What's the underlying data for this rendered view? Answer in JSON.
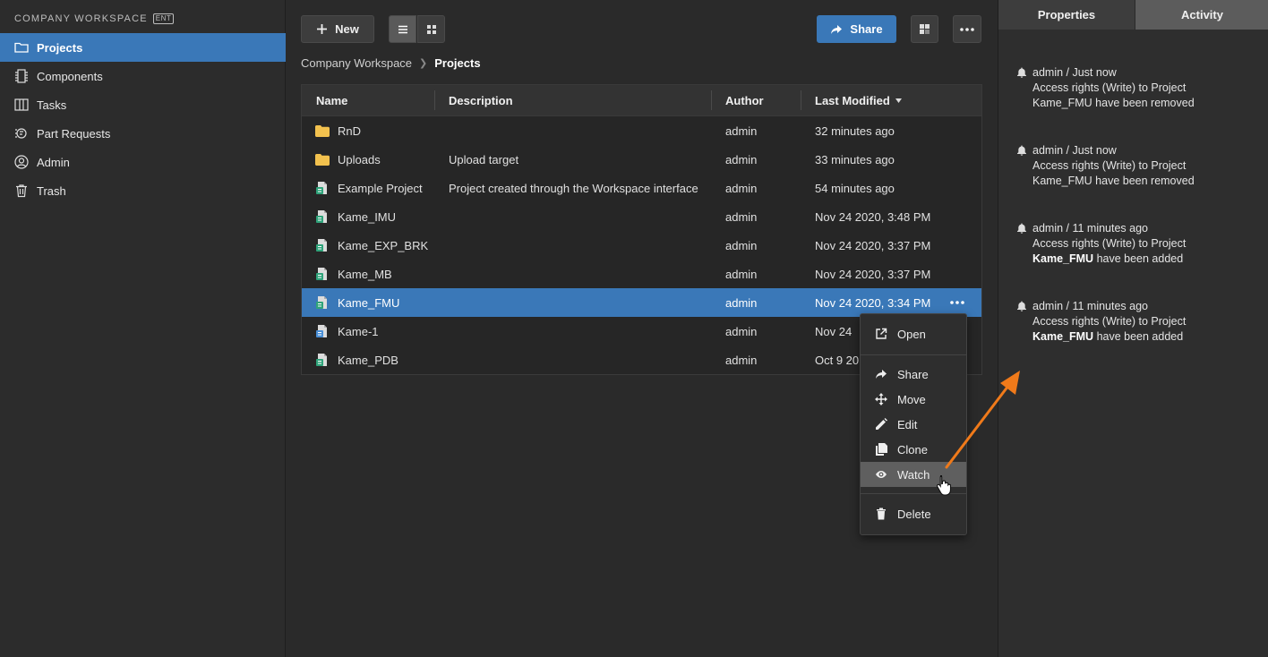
{
  "workspace": {
    "title": "COMPANY WORKSPACE",
    "badge": "ENT"
  },
  "sidebar": {
    "items": [
      {
        "label": "Projects",
        "icon": "folder-icon",
        "active": true
      },
      {
        "label": "Components",
        "icon": "chip-icon",
        "active": false
      },
      {
        "label": "Tasks",
        "icon": "kanban-icon",
        "active": false
      },
      {
        "label": "Part Requests",
        "icon": "part-request-icon",
        "active": false
      },
      {
        "label": "Admin",
        "icon": "user-circle-icon",
        "active": false
      },
      {
        "label": "Trash",
        "icon": "trash-icon",
        "active": false
      }
    ]
  },
  "toolbar": {
    "new_label": "New",
    "share_label": "Share"
  },
  "breadcrumb": {
    "root": "Company Workspace",
    "current": "Projects"
  },
  "table": {
    "columns": [
      "Name",
      "Description",
      "Author",
      "Last Modified"
    ],
    "sort_column": "Last Modified",
    "rows": [
      {
        "type": "folder",
        "name": "RnD",
        "description": "",
        "author": "admin",
        "modified": "32 minutes ago"
      },
      {
        "type": "folder",
        "name": "Uploads",
        "description": "Upload target",
        "author": "admin",
        "modified": "33 minutes ago"
      },
      {
        "type": "project",
        "name": "Example Project",
        "description": "Project created through the Workspace interface",
        "author": "admin",
        "modified": "54 minutes ago"
      },
      {
        "type": "project",
        "name": "Kame_IMU",
        "description": "",
        "author": "admin",
        "modified": "Nov 24 2020, 3:48 PM"
      },
      {
        "type": "project",
        "name": "Kame_EXP_BRK",
        "description": "",
        "author": "admin",
        "modified": "Nov 24 2020, 3:37 PM"
      },
      {
        "type": "project",
        "name": "Kame_MB",
        "description": "",
        "author": "admin",
        "modified": "Nov 24 2020, 3:37 PM"
      },
      {
        "type": "project",
        "name": "Kame_FMU",
        "description": "",
        "author": "admin",
        "modified": "Nov 24 2020, 3:34 PM",
        "selected": true
      },
      {
        "type": "project-blue",
        "name": "Kame-1",
        "description": "",
        "author": "admin",
        "modified": "Nov 24"
      },
      {
        "type": "project",
        "name": "Kame_PDB",
        "description": "",
        "author": "admin",
        "modified": "Oct 9 20"
      }
    ]
  },
  "context_menu": {
    "items": [
      {
        "label": "Open",
        "icon": "open-external-icon"
      },
      {
        "label": "Share",
        "icon": "share-arrow-icon"
      },
      {
        "label": "Move",
        "icon": "move-icon"
      },
      {
        "label": "Edit",
        "icon": "pencil-icon"
      },
      {
        "label": "Clone",
        "icon": "clone-icon"
      },
      {
        "label": "Watch",
        "icon": "eye-icon",
        "hover": true
      },
      {
        "label": "Delete",
        "icon": "trash-icon"
      }
    ]
  },
  "panel": {
    "tabs": [
      "Properties",
      "Activity"
    ],
    "active_tab": "Activity",
    "activities": [
      {
        "header": "admin / Just now",
        "line1": "Access rights (Write) to Project",
        "project": "Kame_FMU",
        "suffix": "have been removed",
        "bold_project": false
      },
      {
        "header": "admin / Just now",
        "line1": "Access rights (Write) to Project",
        "project": "Kame_FMU",
        "suffix": "have been removed",
        "bold_project": false
      },
      {
        "header": "admin / 11 minutes ago",
        "line1": "Access rights (Write) to Project",
        "project": "Kame_FMU",
        "suffix": "have been added",
        "bold_project": true
      },
      {
        "header": "admin / 11 minutes ago",
        "line1": "Access rights (Write) to Project",
        "project": "Kame_FMU",
        "suffix": "have been added",
        "bold_project": true
      }
    ]
  },
  "colors": {
    "accent": "#3a78b8",
    "annotation_arrow": "#f07a1a",
    "folder": "#f2c14e",
    "project": "#2fa37a"
  }
}
